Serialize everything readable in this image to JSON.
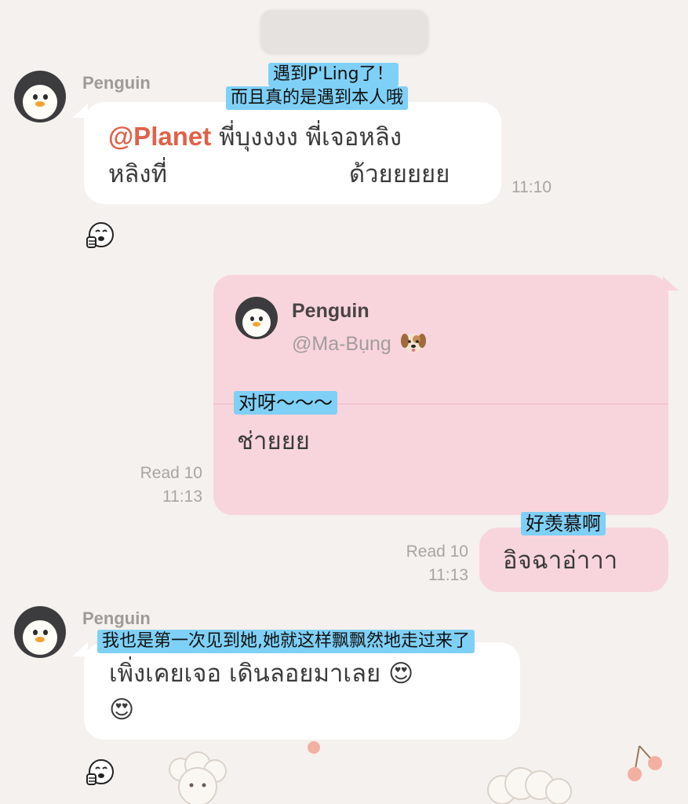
{
  "messages": [
    {
      "sender": "Penguin",
      "annotation_lines": [
        "遇到P'Ling了！",
        "而且真的是遇到本人哦"
      ],
      "mention": "@Planet",
      "text_line1": "พี่บุงงงง พี่เจอหลิง",
      "text_line2_start": "หลิงที่",
      "text_line2_end": "ด้วยยยยย",
      "time": "11:10"
    },
    {
      "reply_to_sender": "Penguin",
      "reply_to_handle": "@Ma-Bụng",
      "annotation": "对呀～～～",
      "text": "ช่ายยย",
      "read": "Read 10",
      "time": "11:13"
    },
    {
      "annotation": "好羡慕啊",
      "text": "อิจฉาอ่าาา",
      "read": "Read 10",
      "time": "11:13"
    },
    {
      "sender": "Penguin",
      "annotation": "我也是第一次见到她,她就这样飘飘然地走过来了",
      "text_line1": "เพิ่งเคยเจอ เดินลอยมาเลย 😍",
      "text_line2": "😍"
    }
  ],
  "icons": {
    "avatar": "penguin-avatar",
    "reaction": "thumbs-up-face-icon",
    "handle_emoji": "dog-face-icon"
  },
  "colors": {
    "background": "#f5f1ee",
    "outgoing_bubble": "#f8d5dc",
    "incoming_bubble": "#ffffff",
    "mention": "#e0614a",
    "annotation_highlight": "#7fd0f6"
  }
}
